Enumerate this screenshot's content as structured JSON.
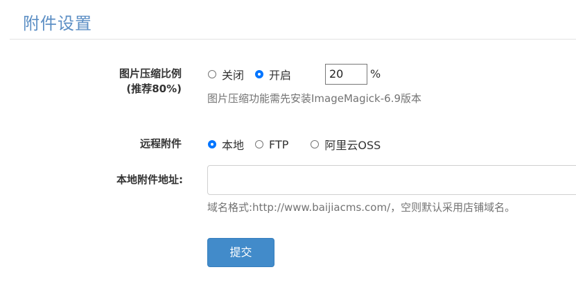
{
  "page": {
    "title": "附件设置"
  },
  "compression": {
    "label_line1": "图片压缩比例",
    "label_line2": "(推荐80%)",
    "options": [
      {
        "label": "关闭",
        "checked": false
      },
      {
        "label": "开启",
        "checked": true
      }
    ],
    "value": "20",
    "unit": "%",
    "help": "图片压缩功能需先安装ImageMagick-6.9版本"
  },
  "remote": {
    "label": "远程附件",
    "options": [
      {
        "label": "本地",
        "checked": true
      },
      {
        "label": "FTP",
        "checked": false
      },
      {
        "label": "阿里云OSS",
        "checked": false
      }
    ]
  },
  "local_address": {
    "label": "本地附件地址:",
    "value": "",
    "help": "域名格式:http://www.baijiacms.com/，空则默认采用店铺域名。"
  },
  "form": {
    "submit_label": "提交"
  },
  "colors": {
    "title": "#5b8ec4",
    "primary_button": "#428bca",
    "radio_checked": "#0075ff"
  }
}
